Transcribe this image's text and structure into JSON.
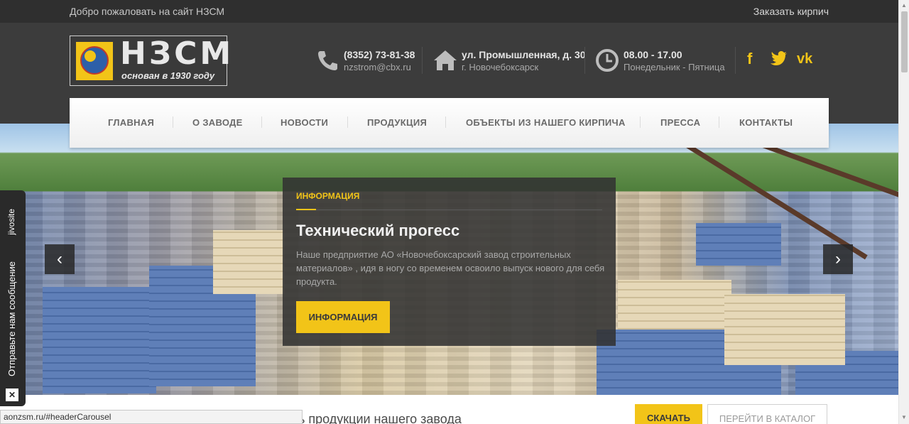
{
  "topbar": {
    "welcome": "Добро пожаловать на сайт НЗСМ",
    "order_link": "Заказать кирпич"
  },
  "logo": {
    "name": "НЗСМ",
    "since": "основан в 1930 году"
  },
  "contacts": {
    "phone": {
      "icon": "phone-icon",
      "line1": "(8352) 73-81-38",
      "line2": "nzstrom@cbx.ru"
    },
    "address": {
      "icon": "home-icon",
      "line1": "ул. Промышленная, д. 30",
      "line2": "г. Новочебоксарск"
    },
    "hours": {
      "icon": "clock-icon",
      "line1": "08.00 - 17.00",
      "line2": "Понедельник - Пятница"
    }
  },
  "social": {
    "facebook": "f",
    "twitter": "twitter-icon",
    "vk": "vk"
  },
  "nav": {
    "items": [
      {
        "label": "ГЛАВНАЯ"
      },
      {
        "label": "О ЗАВОДЕ"
      },
      {
        "label": "НОВОСТИ"
      },
      {
        "label": "ПРОДУКЦИЯ"
      },
      {
        "label": "ОБЪЕКТЫ ИЗ НАШЕГО КИРПИЧА"
      },
      {
        "label": "ПРЕССА"
      },
      {
        "label": "КОНТАКТЫ"
      }
    ]
  },
  "slide": {
    "tag": "ИНФОРМАЦИЯ",
    "title": "Технический прогесс",
    "text": "Наше предприятие АО «Новочебоксарский завод строительных материалов» , идя в ногу со временем освоило выпуск нового для себя продукта.",
    "button": "ИНФОРМАЦИЯ",
    "prev": "‹",
    "next": "›"
  },
  "jivo": {
    "brand": "jivosite",
    "message": "Отправьте нам сообщение",
    "close": "✕"
  },
  "bottom": {
    "heading": "ь продукции нашего завода",
    "download_button": "СКАЧАТЬ",
    "catalog_button": "ПЕРЕЙТИ В КАТАЛОГ"
  },
  "status_url": "aonzsm.ru/#headerCarousel",
  "colors": {
    "accent": "#f2c418",
    "header_bg": "#3c3c3c",
    "topbar_bg": "#2f2f2f"
  }
}
